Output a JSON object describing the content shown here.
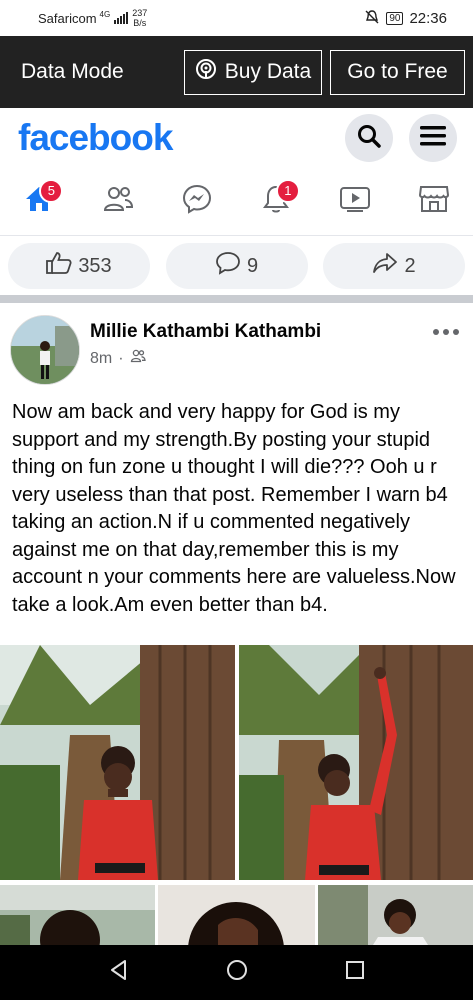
{
  "status_bar": {
    "carrier": "Safaricom",
    "network": "4G",
    "speed_value": "237",
    "speed_unit": "B/s",
    "battery": "90",
    "time": "22:36"
  },
  "data_bar": {
    "title": "Data Mode",
    "buy_label": "Buy Data",
    "free_label": "Go to Free"
  },
  "fb_header": {
    "logo": "facebook",
    "brand_color": "#1877f2"
  },
  "nav": {
    "items": [
      {
        "name": "home",
        "badge": "5",
        "icon": "home-icon"
      },
      {
        "name": "friends",
        "badge": "",
        "icon": "friends-icon"
      },
      {
        "name": "messenger",
        "badge": "",
        "icon": "messenger-icon"
      },
      {
        "name": "notifications",
        "badge": "1",
        "icon": "bell-icon"
      },
      {
        "name": "watch",
        "badge": "",
        "icon": "video-icon"
      },
      {
        "name": "marketplace",
        "badge": "",
        "icon": "shop-icon"
      }
    ]
  },
  "reactions": {
    "likes": "353",
    "comments": "9",
    "shares": "2"
  },
  "post": {
    "author": "Millie Kathambi Kathambi",
    "time": "8m",
    "separator": "·",
    "text": "Now am back and very happy for God is my support and my strength.By posting your stupid thing on fun zone u thought I will die??? Ooh u r  very useless than that post. Remember I warn b4 taking an action.N if u commented negatively against me on that day,remember this is my account n your comments here are valueless.Now take a look.Am even better than b4."
  }
}
